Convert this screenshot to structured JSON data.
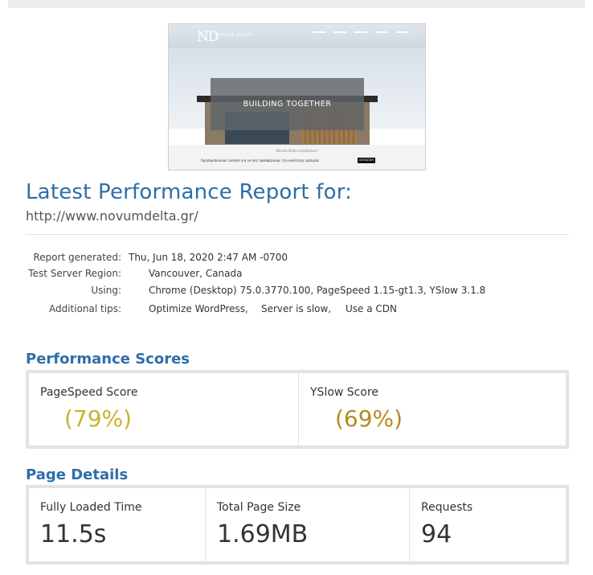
{
  "thumbnail": {
    "logo": "ND",
    "brand": "NOVUM DELTA",
    "banner": "BUILDING TOGETHER",
    "caption": "Novum Delta architecture",
    "cookie_text": "Χρησιμοποιούμε cookies για να σας προσφέρουμε την καλύτερη εμπειρία",
    "button": "ΑΠΟΔΟΧΗ"
  },
  "report": {
    "title": "Latest Performance Report for:",
    "url": "http://www.novumdelta.gr/",
    "generated_label": "Report generated:",
    "generated_value": "Thu, Jun 18, 2020 2:47 AM -0700",
    "region_label": "Test Server Region:",
    "region_value": "Vancouver, Canada",
    "using_label": "Using:",
    "using_value": "Chrome (Desktop) 75.0.3770.100, PageSpeed 1.15-gt1.3, YSlow 3.1.8",
    "tips_label": "Additional tips:",
    "tips": [
      "Optimize WordPress,",
      "Server is slow,",
      "Use a CDN"
    ]
  },
  "scores": {
    "section_title": "Performance Scores",
    "pagespeed_label": "PageSpeed Score",
    "pagespeed_value": "(79%)",
    "yslow_label": "YSlow Score",
    "yslow_value": "(69%)",
    "pagespeed_color": "#c9b42a",
    "yslow_color": "#b58a22"
  },
  "details": {
    "section_title": "Page Details",
    "loaded_label": "Fully Loaded Time",
    "loaded_value": "11.5s",
    "size_label": "Total Page Size",
    "size_value": "1.69MB",
    "requests_label": "Requests",
    "requests_value": "94"
  }
}
